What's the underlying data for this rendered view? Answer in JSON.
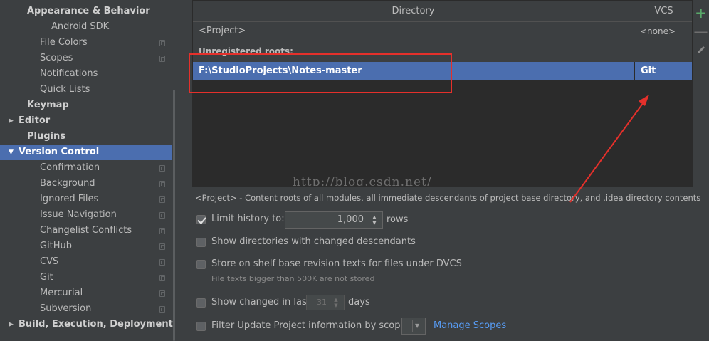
{
  "sidebar": {
    "items": [
      {
        "label": "Appearance & Behavior",
        "level": 0,
        "bold": true,
        "selected": false,
        "copy": false
      },
      {
        "label": "Android SDK",
        "level": 2,
        "bold": false,
        "selected": false,
        "copy": false
      },
      {
        "label": "File Colors",
        "level": 1,
        "bold": false,
        "selected": false,
        "copy": true
      },
      {
        "label": "Scopes",
        "level": 1,
        "bold": false,
        "selected": false,
        "copy": true
      },
      {
        "label": "Notifications",
        "level": 1,
        "bold": false,
        "selected": false,
        "copy": false
      },
      {
        "label": "Quick Lists",
        "level": 1,
        "bold": false,
        "selected": false,
        "copy": false
      },
      {
        "label": "Keymap",
        "level": 0,
        "bold": true,
        "selected": false,
        "copy": false
      },
      {
        "label": "Editor",
        "level": 0,
        "bold": true,
        "selected": false,
        "copy": false,
        "arrow": "▶"
      },
      {
        "label": "Plugins",
        "level": 0,
        "bold": true,
        "selected": false,
        "copy": false
      },
      {
        "label": "Version Control",
        "level": 0,
        "bold": true,
        "selected": true,
        "copy": false,
        "arrow": "▼"
      },
      {
        "label": "Confirmation",
        "level": 1,
        "bold": false,
        "selected": false,
        "copy": true
      },
      {
        "label": "Background",
        "level": 1,
        "bold": false,
        "selected": false,
        "copy": true
      },
      {
        "label": "Ignored Files",
        "level": 1,
        "bold": false,
        "selected": false,
        "copy": true
      },
      {
        "label": "Issue Navigation",
        "level": 1,
        "bold": false,
        "selected": false,
        "copy": true
      },
      {
        "label": "Changelist Conflicts",
        "level": 1,
        "bold": false,
        "selected": false,
        "copy": true
      },
      {
        "label": "GitHub",
        "level": 1,
        "bold": false,
        "selected": false,
        "copy": true
      },
      {
        "label": "CVS",
        "level": 1,
        "bold": false,
        "selected": false,
        "copy": true
      },
      {
        "label": "Git",
        "level": 1,
        "bold": false,
        "selected": false,
        "copy": true
      },
      {
        "label": "Mercurial",
        "level": 1,
        "bold": false,
        "selected": false,
        "copy": true
      },
      {
        "label": "Subversion",
        "level": 1,
        "bold": false,
        "selected": false,
        "copy": true
      },
      {
        "label": "Build, Execution, Deployment",
        "level": 0,
        "bold": true,
        "selected": false,
        "copy": false,
        "arrow": "▶"
      }
    ]
  },
  "table": {
    "header_directory": "Directory",
    "header_vcs": "VCS",
    "project_row": {
      "directory": "<Project>",
      "vcs": "<none>"
    },
    "unregistered_label": "Unregistered roots:",
    "selected_row": {
      "directory": "F:\\StudioProjects\\Notes-master",
      "vcs": "Git"
    },
    "watermark": "http://blog.csdn.net/"
  },
  "toolbar": {
    "add": "+",
    "remove": "—",
    "edit_icon": "pencil-icon"
  },
  "description": "<Project> - Content roots of all modules, all immediate descendants of project base directory, and .idea directory contents",
  "options": {
    "limit_history": {
      "label": "Limit history to:",
      "checked": true,
      "value": "1,000",
      "suffix": "rows"
    },
    "show_dirs": {
      "label": "Show directories with changed descendants",
      "checked": false
    },
    "shelf": {
      "label": "Store on shelf base revision texts for files under DVCS",
      "checked": false,
      "hint": "File texts bigger than 500K are not stored"
    },
    "show_changed": {
      "label": "Show changed in last",
      "checked": false,
      "value": "31",
      "suffix": "days"
    },
    "filter_update": {
      "label": "Filter Update Project information by scope",
      "checked": false,
      "link": "Manage Scopes"
    }
  },
  "colors": {
    "selection": "#4b6eaf",
    "annotation": "#e5302b",
    "link": "#589df6",
    "add": "#59a869"
  }
}
